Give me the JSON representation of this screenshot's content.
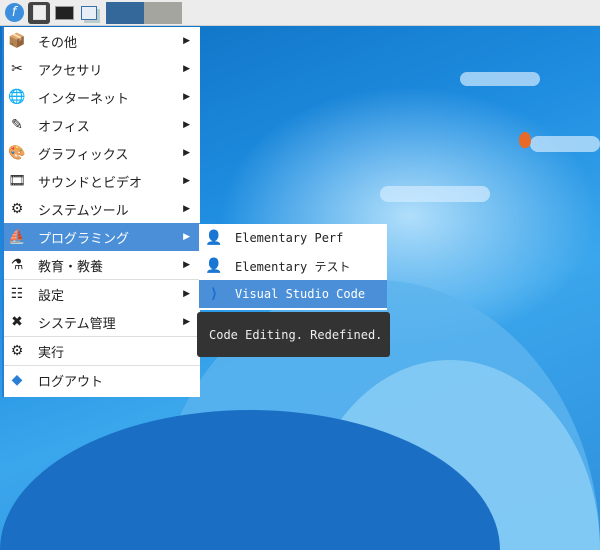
{
  "panel": {
    "icons": [
      "fedora-logo-icon",
      "file-cabinet-icon",
      "monitor-icon",
      "windows-icon"
    ],
    "workspaces": [
      "workspace-1",
      "workspace-2"
    ]
  },
  "menu": {
    "items": [
      {
        "label": "その他",
        "icon": "misc-box-icon",
        "glyph": "📦"
      },
      {
        "label": "アクセサリ",
        "icon": "accessories-icon",
        "glyph": "✂"
      },
      {
        "label": "インターネット",
        "icon": "globe-icon",
        "glyph": "🌐"
      },
      {
        "label": "オフィス",
        "icon": "office-icon",
        "glyph": "✎"
      },
      {
        "label": "グラフィックス",
        "icon": "palette-icon",
        "glyph": "🎨"
      },
      {
        "label": "サウンドとビデオ",
        "icon": "film-icon",
        "glyph": "🎞"
      },
      {
        "label": "システムツール",
        "icon": "gear-icon",
        "glyph": "⚙"
      },
      {
        "label": "プログラミング",
        "icon": "programming-icon",
        "glyph": "⛵"
      },
      {
        "label": "教育・教養",
        "icon": "flask-icon",
        "glyph": "⚗"
      },
      {
        "label": "設定",
        "icon": "settings-icon",
        "glyph": "☷"
      },
      {
        "label": "システム管理",
        "icon": "tools-icon",
        "glyph": "✖"
      },
      {
        "label": "実行",
        "icon": "run-icon",
        "glyph": "⚙"
      },
      {
        "label": "ログアウト",
        "icon": "logout-icon",
        "glyph": "◆"
      }
    ]
  },
  "submenu": {
    "items": [
      {
        "label": "Elementary Perf",
        "icon": "person-icon",
        "glyph": "👤"
      },
      {
        "label": "Elementary テスト",
        "icon": "person-icon",
        "glyph": "👤"
      },
      {
        "label": "Visual Studio Code",
        "icon": "vscode-icon",
        "glyph": "⟩"
      }
    ]
  },
  "tooltip": "Code Editing. Redefined.",
  "colors": {
    "accent": "#4a8fd8",
    "tooltip_bg": "#333333"
  }
}
